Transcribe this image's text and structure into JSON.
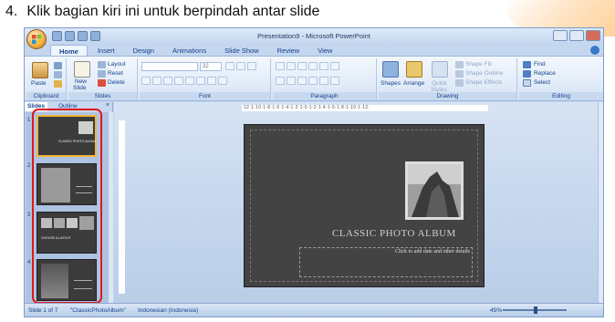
{
  "caption": {
    "number": "4.",
    "text": "Klik bagian kiri ini untuk berpindah antar slide"
  },
  "window": {
    "title": "Presentation9 - Microsoft PowerPoint"
  },
  "tabs": [
    "Home",
    "Insert",
    "Design",
    "Animations",
    "Slide Show",
    "Review",
    "View"
  ],
  "ribbon": {
    "clipboard": {
      "paste": "Paste",
      "label": "Clipboard"
    },
    "slides": {
      "new_slide": "New",
      "new_slide2": "Slide",
      "layout": "Layout",
      "reset": "Reset",
      "delete": "Delete",
      "label": "Slides"
    },
    "font": {
      "size": "32",
      "label": "Font"
    },
    "paragraph": {
      "label": "Paragraph"
    },
    "drawing": {
      "shapes": "Shapes",
      "arrange": "Arrange",
      "quick": "Quick",
      "styles": "Styles",
      "fill": "Shape Fill",
      "outline": "Shape Outline",
      "effects": "Shape Effects",
      "label": "Drawing"
    },
    "editing": {
      "find": "Find",
      "replace": "Replace",
      "select": "Select",
      "label": "Editing"
    }
  },
  "pane": {
    "tab_slides": "Slides",
    "tab_outline": "Outline",
    "close": "×",
    "numbers": [
      "1",
      "2",
      "3",
      "4"
    ]
  },
  "thumbs": {
    "t1": "CLASSIC PHOTO ALBUM",
    "t3": "CHOOSE A LAYOUT"
  },
  "ruler": "·12·1·10·1·8·1·6·1·4·1·2·1·0·1·2·1·4·1·6·1·8·1·10·1·12·",
  "slide": {
    "title": "CLASSIC PHOTO ALBUM",
    "subtitle_placeholder": "Click to add date and other details"
  },
  "status": {
    "slide": "Slide 1 of 7",
    "theme": "\"ClassicPhotoAlbum\"",
    "language": "Indonesian (Indonesia)",
    "zoom": "45%"
  },
  "colors": {
    "highlight": "#e3171c",
    "slide_bg": "#434343"
  }
}
